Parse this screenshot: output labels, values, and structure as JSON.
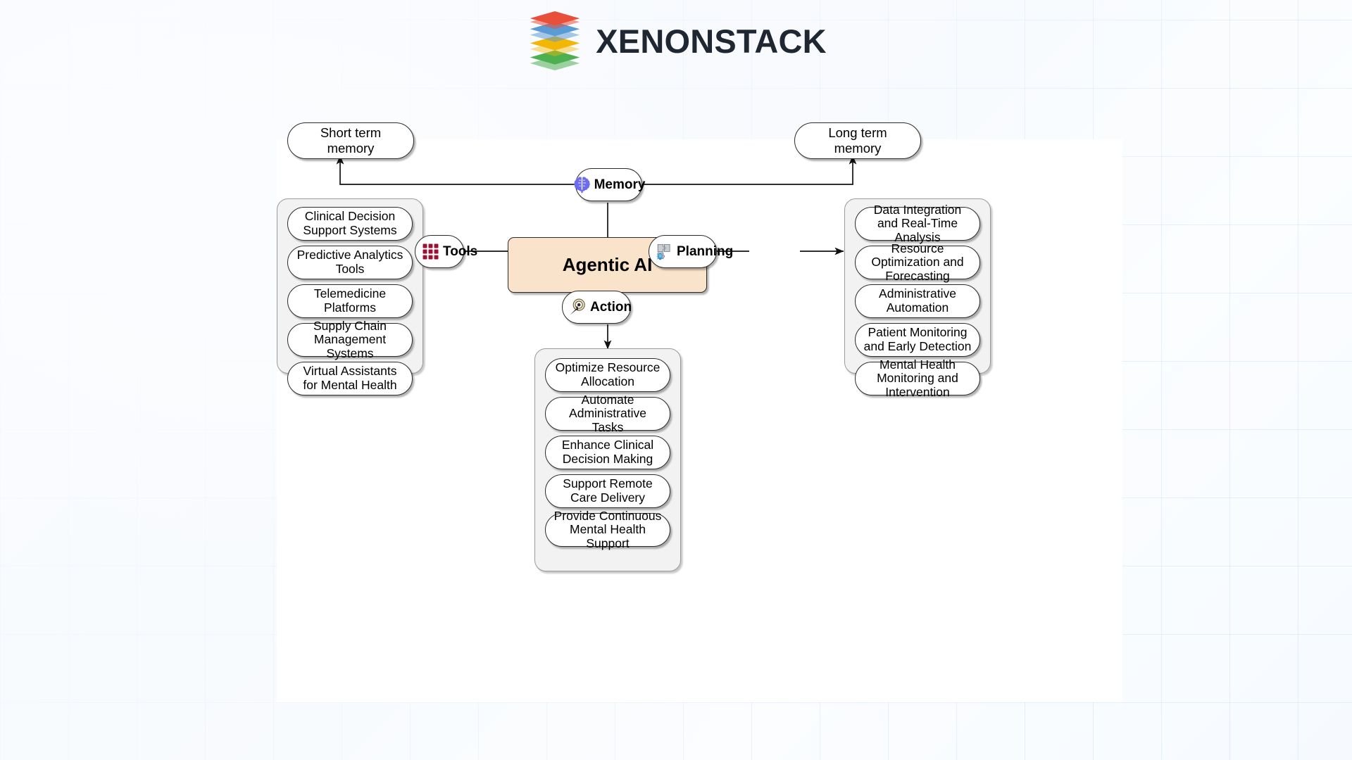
{
  "brand": {
    "name": "XENONSTACK",
    "logo_icon": "stacked-layers-icon",
    "layer_colors": [
      "#e8503a",
      "#5b9bd5",
      "#f2b705",
      "#4caf50"
    ]
  },
  "diagram": {
    "type": "agentic-ai-architecture",
    "core": {
      "label": "Agentic AI",
      "fill": "#fae3cb",
      "stroke": "#2b2b2b"
    },
    "hubs": [
      {
        "id": "memory",
        "label": "Memory",
        "icon": "brain-icon",
        "icon_color": "#6b6bf0"
      },
      {
        "id": "tools",
        "label": "Tools",
        "icon": "grid-squares-icon",
        "icon_color": "#9c1132"
      },
      {
        "id": "planning",
        "label": "Planning",
        "icon": "puzzle-lightbulb-icon",
        "icon_color": "#9aa3ad"
      },
      {
        "id": "action",
        "label": "Action",
        "icon": "target-cursor-icon",
        "icon_color": "#6b5a33"
      }
    ],
    "memory_children": [
      {
        "label": "Short term memory"
      },
      {
        "label": "Long term memory"
      }
    ],
    "tools_group": {
      "items": [
        "Clinical Decision Support Systems",
        "Predictive Analytics Tools",
        "Telemedicine Platforms",
        "Supply Chain Management Systems",
        "Virtual Assistants for Mental Health"
      ]
    },
    "planning_group": {
      "items": [
        "Data Integration and Real-Time Analysis",
        "Resource Optimization and Forecasting",
        "Administrative Automation",
        "Patient Monitoring and Early Detection",
        "Mental Health Monitoring and Intervention"
      ]
    },
    "action_group": {
      "items": [
        "Optimize Resource Allocation",
        "Automate Administrative Tasks",
        "Enhance Clinical Decision Making",
        "Support Remote Care Delivery",
        "Provide Continuous Mental Health Support"
      ]
    },
    "group_style": {
      "fill": "#f2f2f2",
      "stroke": "#9a9a9a"
    }
  }
}
